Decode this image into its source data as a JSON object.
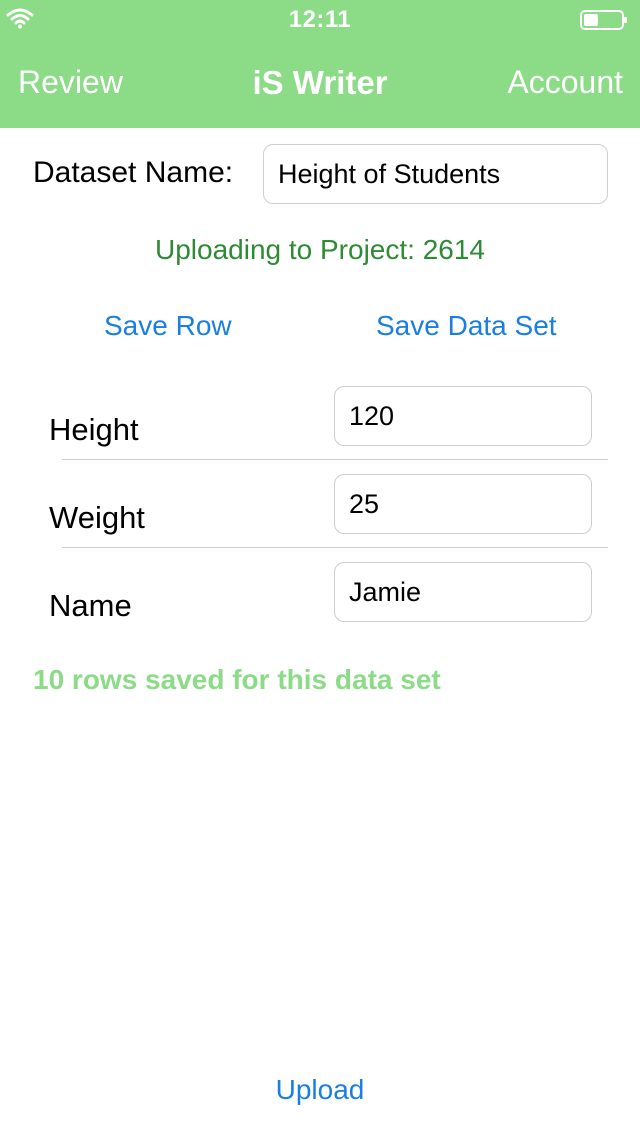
{
  "status_bar": {
    "time": "12:11",
    "wifi_icon": "wifi-icon",
    "battery_icon": "battery-icon"
  },
  "nav": {
    "left_label": "Review",
    "title": "iS Writer",
    "right_label": "Account"
  },
  "dataset": {
    "label": "Dataset Name:",
    "value": "Height of Students"
  },
  "uploading_text": "Uploading to Project: 2614",
  "actions": {
    "save_row": "Save Row",
    "save_data_set": "Save Data Set"
  },
  "fields": [
    {
      "label": "Height",
      "value": "120"
    },
    {
      "label": "Weight",
      "value": "25"
    },
    {
      "label": "Name",
      "value": "Jamie"
    }
  ],
  "rows_saved_text": "10 rows saved for this data set",
  "upload_label": "Upload",
  "colors": {
    "header_green": "#8bdb87",
    "project_text_green": "#2e8b35",
    "link_blue": "#1a7fe0"
  }
}
